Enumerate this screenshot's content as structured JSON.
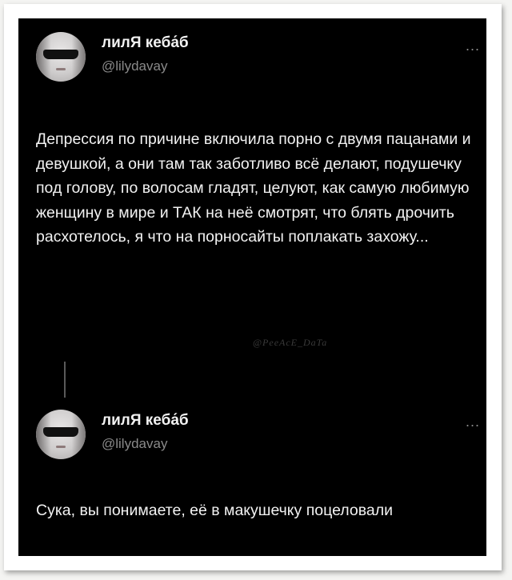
{
  "tweets": [
    {
      "author_name": "лилЯ кеба́б",
      "author_handle": "@lilydavay",
      "more": "...",
      "text": "Депрессия по причине включила порно с двумя пацанами и девушкой, а они там так заботливо всё делают, подушечку под голову, по волосам гладят, целуют, как самую любимую женщину в мире и ТАК на неё смотрят, что блять дрочить расхотелось, я что на порносайты поплакать захожу..."
    },
    {
      "author_name": "лилЯ кеба́б",
      "author_handle": "@lilydavay",
      "more": "...",
      "text": "Сука, вы понимаете, её в макушечку поцеловали"
    }
  ],
  "watermark": "@PeeAcE_DaTa"
}
